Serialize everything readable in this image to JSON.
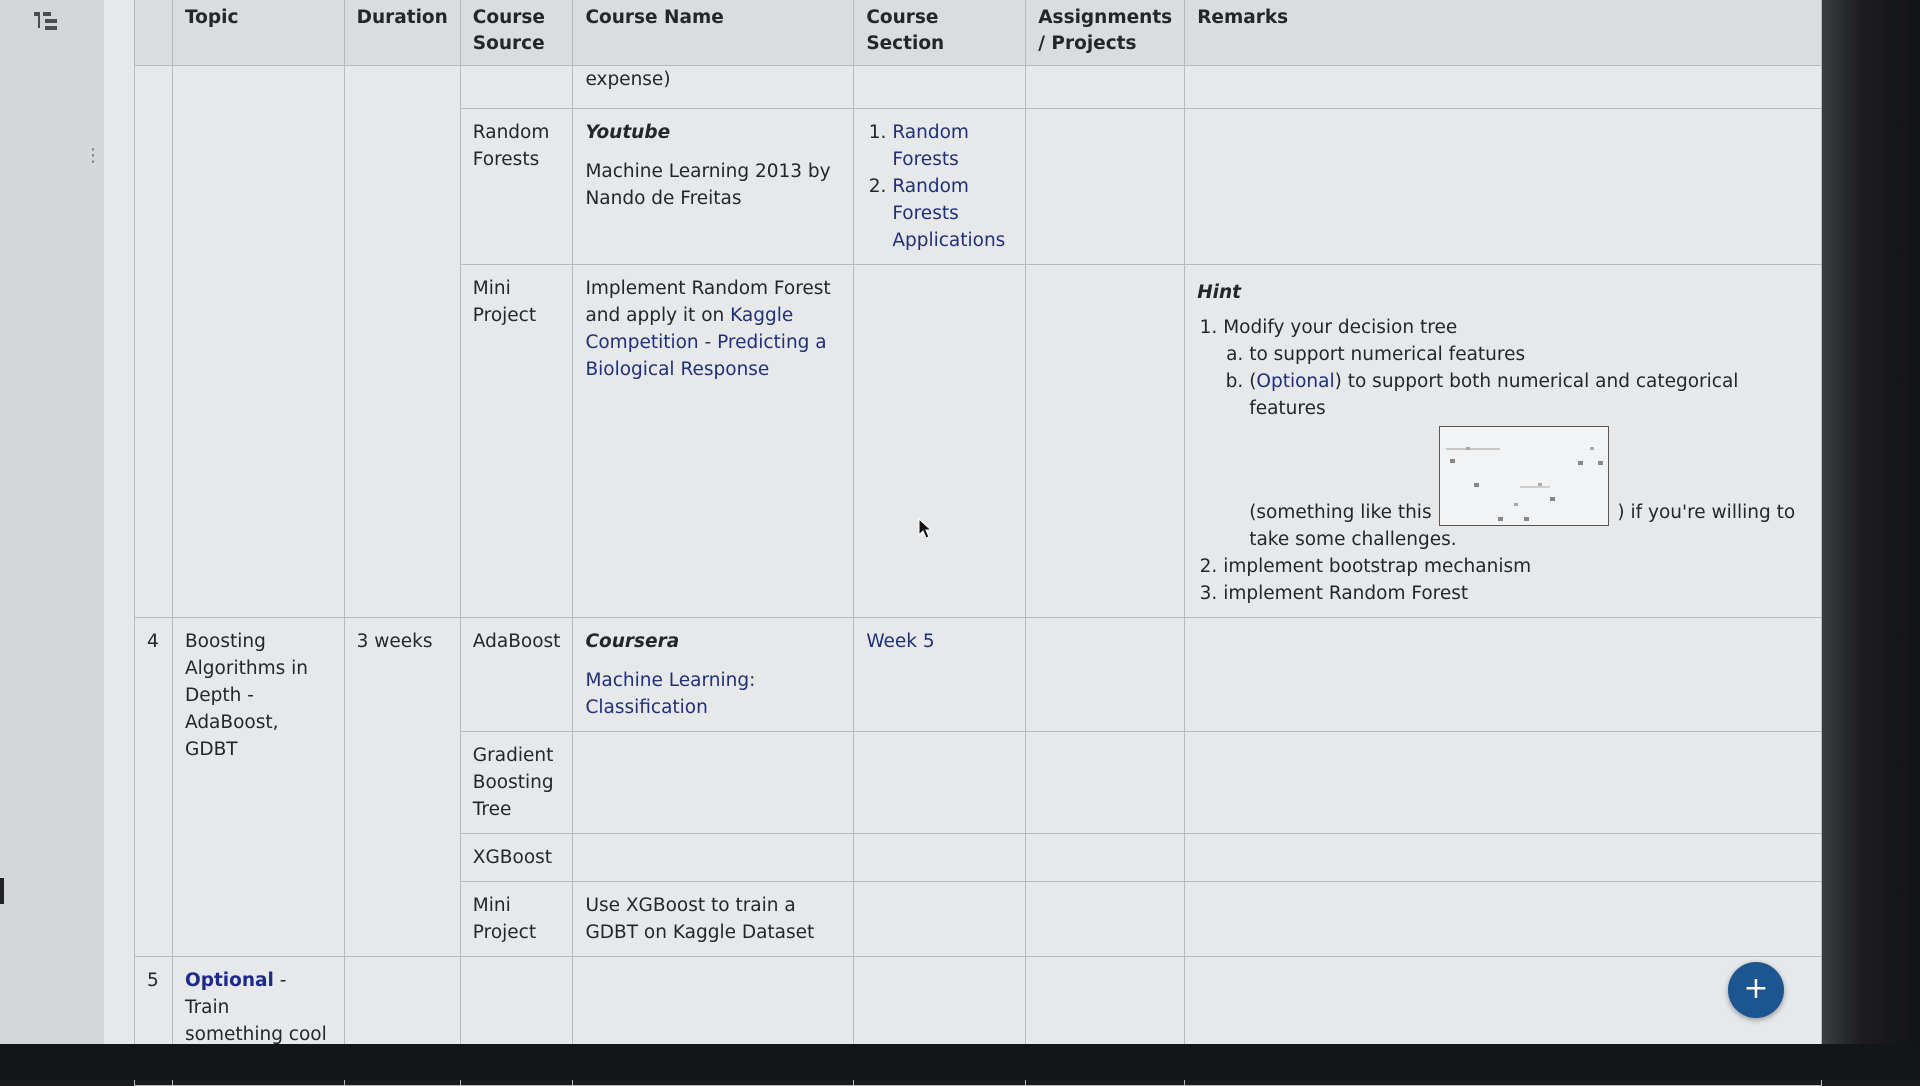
{
  "headers": {
    "topic": "Topic",
    "duration": "Duration",
    "course_source": "Course Source",
    "course_name": "Course Name",
    "course_section": "Course Section",
    "assignments": "Assignments / Projects",
    "remarks": "Remarks"
  },
  "row3": {
    "partial_name": "expense)",
    "random_forests": {
      "source": "Random Forests",
      "platform": "Youtube",
      "name": "Machine Learning 2013 by Nando de Freitas",
      "sections": [
        "Random Forests",
        "Random Forests Applications"
      ]
    },
    "mini_project": {
      "source": "Mini Project",
      "name_prefix": "Implement Random Forest and apply it on ",
      "name_link": "Kaggle Competition - Predicting a Biological Response",
      "hint_title": "Hint",
      "hint_1": "Modify your decision tree",
      "hint_1a": "to support numerical features",
      "hint_1b_open": "(",
      "hint_1b_link": "Optional",
      "hint_1b_rest": ") to support both numerical and categorical features",
      "hint_1b_pre_image": "(something like this",
      "hint_1b_post_image": ") if you're willing to take some challenges.",
      "hint_2": "implement bootstrap mechanism",
      "hint_3": "implement Random Forest"
    }
  },
  "row4": {
    "number": "4",
    "topic": "Boosting Algorithms in Depth - AdaBoost, GDBT",
    "duration": "3 weeks",
    "adaboost": {
      "source": "AdaBoost",
      "platform": "Coursera",
      "name": "Machine Learning: Classification",
      "section": "Week 5"
    },
    "gbt": {
      "source": "Gradient Boosting Tree"
    },
    "xgboost": {
      "source": "XGBoost"
    },
    "mini_project": {
      "source": "Mini Project",
      "name": "Use XGBoost to train a GDBT on Kaggle Dataset"
    }
  },
  "row5": {
    "number": "5",
    "topic_link": "Optional",
    "topic_rest": " - Train something cool"
  },
  "fab_label": "+",
  "icons": {
    "outline": "outline-icon",
    "fab": "plus-icon",
    "cursor": "mouse-pointer-icon",
    "smiley": "smiley-emoji-icon"
  },
  "colors": {
    "link": "#1f2f7a",
    "fab": "#1c5590",
    "emoji": "#e6c02c"
  }
}
